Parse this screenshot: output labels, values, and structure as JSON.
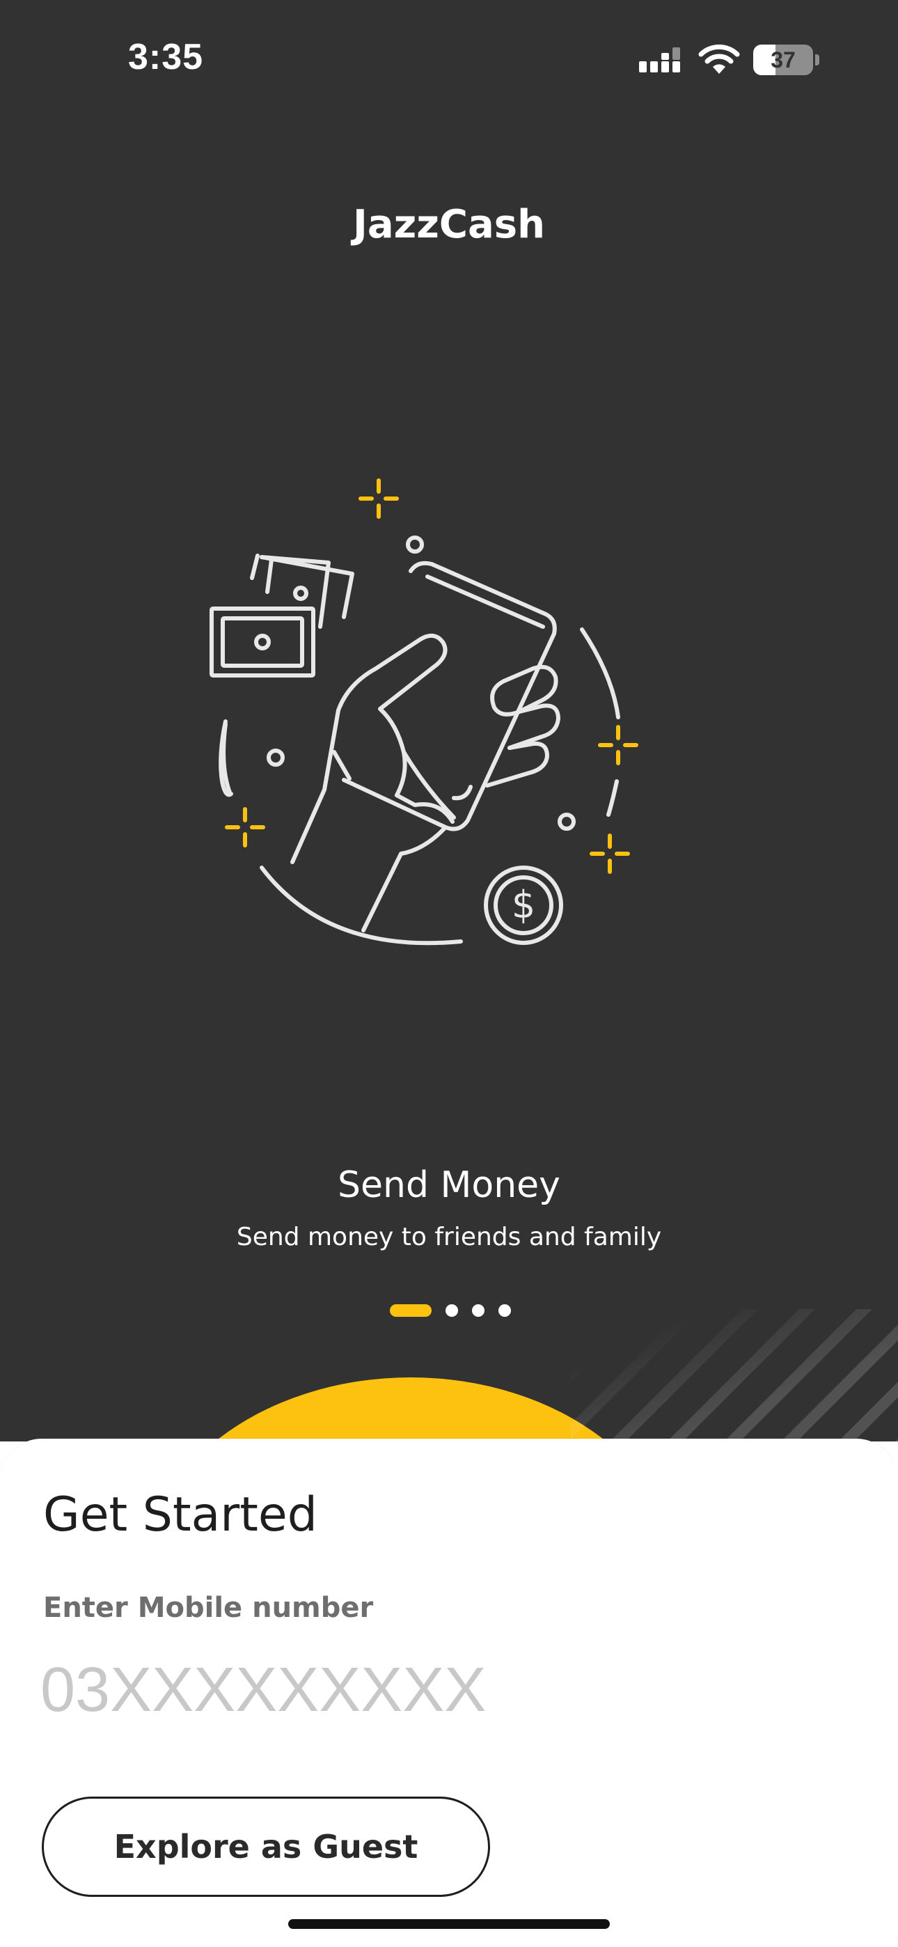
{
  "status_bar": {
    "time": "3:35",
    "battery_percent": "37",
    "battery_level": 0.37,
    "icons": [
      "cellular-signal-icon",
      "wifi-icon",
      "battery-icon"
    ]
  },
  "header": {
    "app_name": "JazzCash"
  },
  "onboarding": {
    "illustration": "hand-holding-phone-send-money",
    "title": "Send Money",
    "subtitle": "Send money to friends and family",
    "pager": {
      "total": 4,
      "active_index": 0
    }
  },
  "get_started": {
    "heading": "Get Started",
    "mobile_label": "Enter Mobile number",
    "mobile_placeholder": "03XXXXXXXXX",
    "mobile_value": "",
    "guest_button_label": "Explore as Guest"
  },
  "colors": {
    "background_dark": "#323232",
    "accent_yellow": "#FDC20F",
    "sheet_white": "#FFFFFF",
    "text_dark": "#1E1E1E",
    "label_gray": "#6E6E6E",
    "placeholder_gray": "#C8C8C8"
  }
}
